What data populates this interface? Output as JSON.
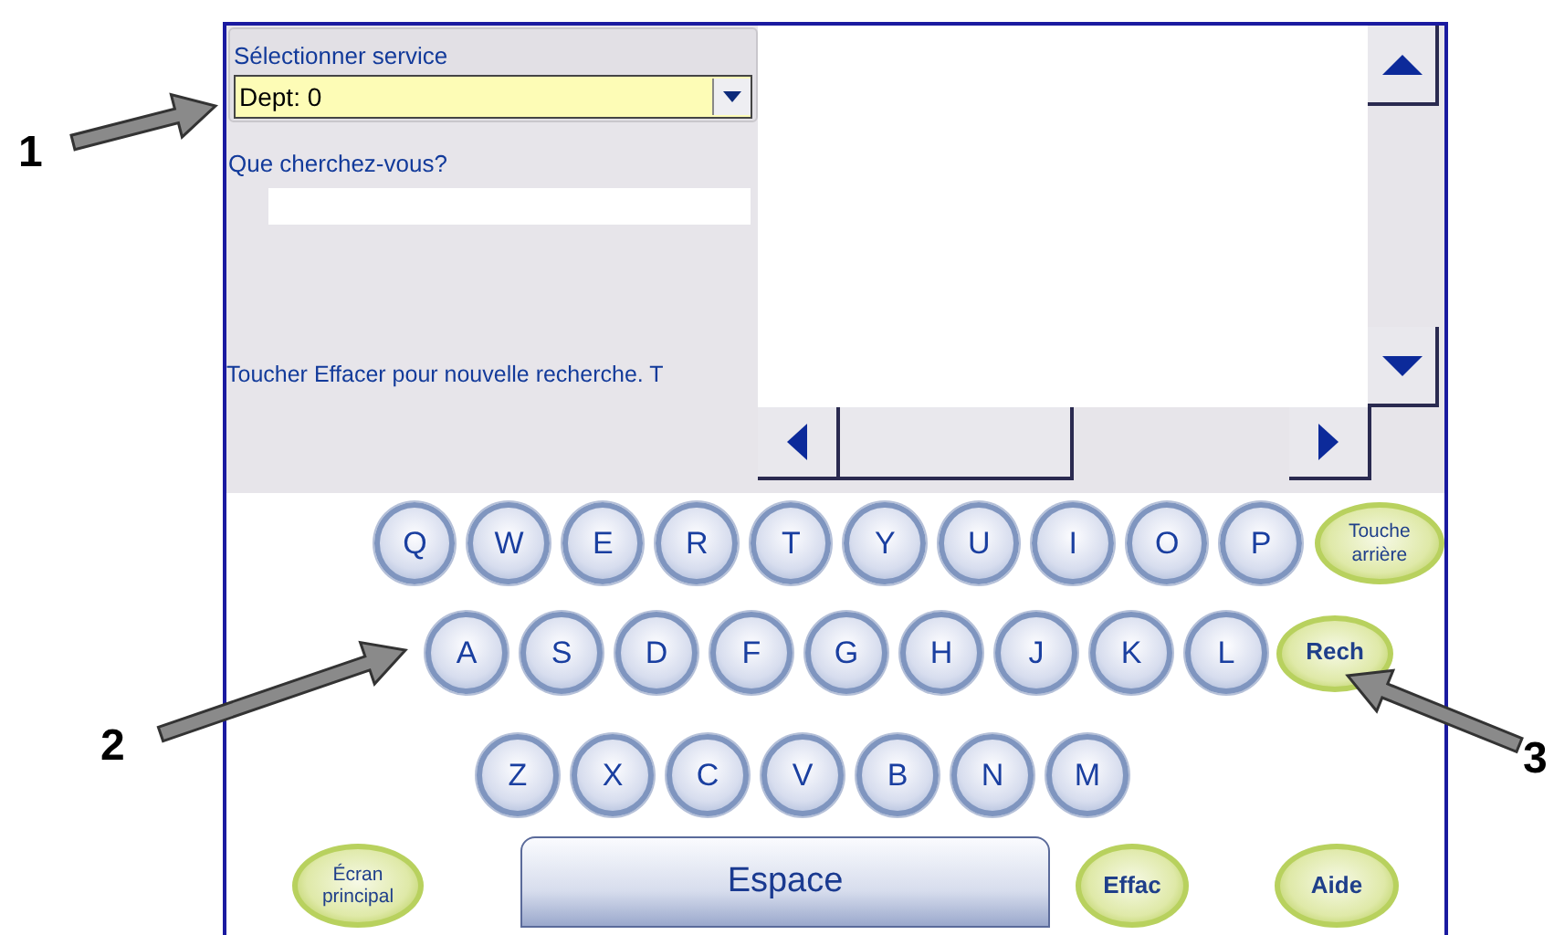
{
  "department": {
    "label": "Sélectionner service",
    "value": "Dept: 0"
  },
  "search": {
    "label": "Que cherchez-vous?"
  },
  "hint": "Toucher Effacer pour nouvelle recherche. T",
  "keyboard": {
    "rows": [
      {
        "keys": [
          "Q",
          "W",
          "E",
          "R",
          "T",
          "Y",
          "U",
          "I",
          "O",
          "P"
        ],
        "action": "Touche arrière"
      },
      {
        "keys": [
          "A",
          "S",
          "D",
          "F",
          "G",
          "H",
          "J",
          "K",
          "L"
        ],
        "action": "Rech"
      },
      {
        "keys": [
          "Z",
          "X",
          "C",
          "V",
          "B",
          "N",
          "M"
        ]
      }
    ],
    "bottom": [
      {
        "kind": "action",
        "label": "Écran principal"
      },
      {
        "kind": "space",
        "label": "Espace"
      },
      {
        "kind": "action",
        "label": "Effac"
      },
      {
        "kind": "action",
        "label": "Aide"
      }
    ]
  },
  "callouts": [
    "1",
    "2",
    "3"
  ]
}
